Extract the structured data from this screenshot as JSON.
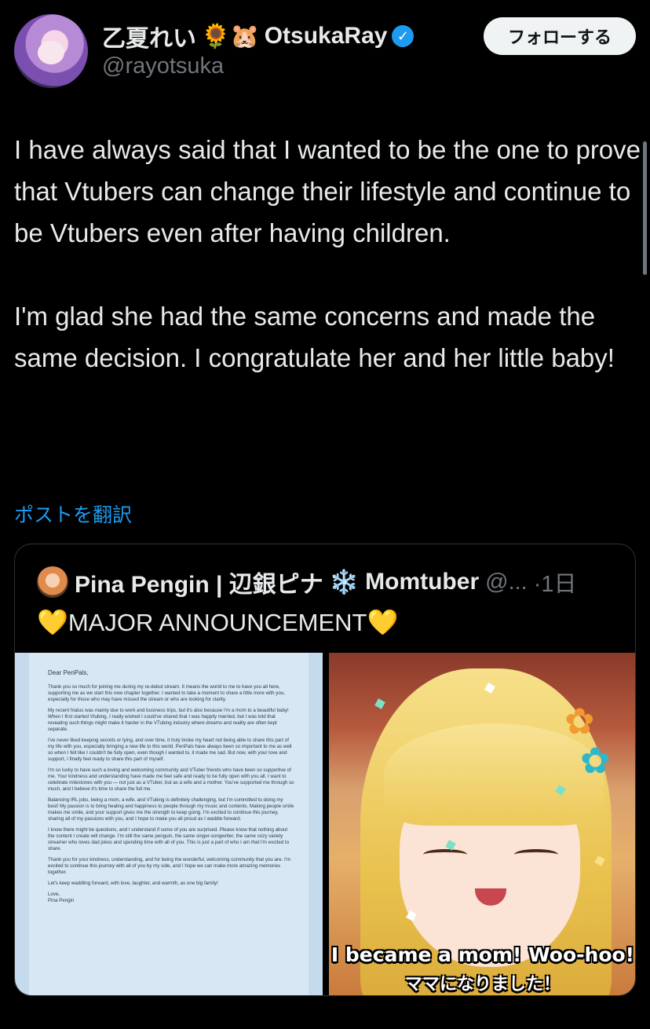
{
  "author": {
    "display_name": "乙夏れい",
    "name_emojis": "🌻🐹",
    "display_name_en": "OtsukaRay",
    "handle": "@rayotsuka",
    "verified_icon": "✓"
  },
  "follow_button": {
    "label": "フォローする"
  },
  "tweet": {
    "text": "I have always said that I wanted to be the one to prove that Vtubers can change their lifestyle and continue to be Vtubers even after having children.\n\nI'm glad she had the same concerns and made the same decision. I congratulate her and her little baby!"
  },
  "translate_link": "ポストを翻訳",
  "quote": {
    "name": "Pina Pengin | 辺銀ピナ",
    "snowflake": "❄️",
    "name_suffix": "Momtuber",
    "handle": "@...",
    "time": "·1日",
    "text": "MAJOR ANNOUNCEMENT",
    "heart": "💛",
    "letter": {
      "greeting": "Dear PenPals,",
      "paragraphs": [
        "Thank you so much for joining me during my re-debut stream. It means the world to me to have you all here, supporting me as we start this new chapter together. I wanted to take a moment to share a little more with you, especially for those who may have missed the stream or who are looking for clarity.",
        "My recent hiatus was mainly due to work and business trips, but it's also because I'm a mom to a beautiful baby! When I first started Vtubing, I really wished I could've shared that I was happily married, but I was told that revealing such things might make it harder in the VTubing industry where dreams and reality are often kept separate.",
        "I've never liked keeping secrets or lying, and over time, it truly broke my heart not being able to share this part of my life with you, especially bringing a new life to this world. PenPals have always been so important to me as well so when I felt like I couldn't be fully open, even though I wanted to, it made me sad. But now, with your love and support, I finally feel ready to share this part of myself.",
        "I'm so lucky to have such a loving and welcoming community and VTuber friends who have been so supportive of me. Your kindness and understanding have made me feel safe and ready to be fully open with you all. I want to celebrate milestones with you — not just as a VTuber, but as a wife and a mother. You've supported me through so much, and I believe it's time to share the full me.",
        "Balancing IRL jobs, being a mom, a wife, and VTubing is definitely challenging, but I'm committed to doing my best! My passion is to bring healing and happiness to people through my music and contents. Making people smile makes me smile, and your support gives me the strength to keep going. I'm excited to continue this journey, sharing all of my passions with you, and I hope to make you all proud as I waddle forward.",
        "I know there might be questions, and I understand if some of you are surprised. Please know that nothing about the content I create will change. I'm still the same penguin, the same singer-songwriter, the same cozy variety streamer who loves dad jokes and spending time with all of you. This is just a part of who I am that I'm excited to share.",
        "Thank you for your kindness, understanding, and for being the wonderful, welcoming community that you are. I'm excited to continue this journey with all of you by my side, and I hope we can make more amazing memories together.",
        "Let's keep waddling forward, with love, laughter, and warmth, as one big family!",
        "Love,\nPina Pengin"
      ]
    },
    "image_subtitle_en": "I became a mom! Woo-hoo!",
    "image_subtitle_jp": "ママになりました！"
  }
}
